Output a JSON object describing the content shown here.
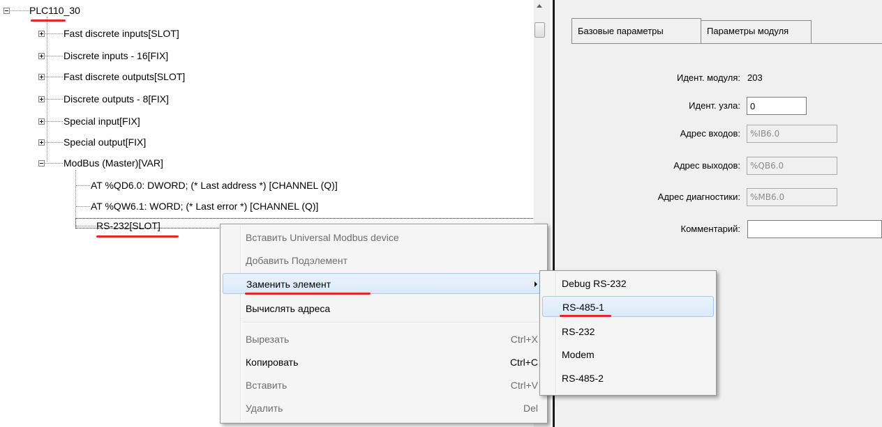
{
  "tree": {
    "root": "PLC110_30",
    "items": [
      "Fast discrete inputs[SLOT]",
      "Discrete inputs - 16[FIX]",
      "Fast discrete outputs[SLOT]",
      "Discrete outputs - 8[FIX]",
      "Special input[FIX]",
      "Special output[FIX]",
      "ModBus (Master)[VAR]"
    ],
    "modbus_children": [
      "AT %QD6.0: DWORD; (* Last address *) [CHANNEL (Q)]",
      "AT %QW6.1: WORD; (* Last error *) [CHANNEL (Q)]",
      "RS-232[SLOT]"
    ]
  },
  "tabs": [
    "Базовые параметры",
    "Параметры модуля"
  ],
  "form": {
    "module_id_label": "Идент. модуля:",
    "module_id_value": "203",
    "node_id_label": "Идент. узла:",
    "node_id_value": "0",
    "input_addr_label": "Адрес входов:",
    "input_addr_value": "%IB6.0",
    "output_addr_label": "Адрес выходов:",
    "output_addr_value": "%QB6.0",
    "diag_addr_label": "Адрес диагностики:",
    "diag_addr_value": "%MB6.0",
    "comment_label": "Комментарий:",
    "comment_value": ""
  },
  "context_menu": {
    "items": [
      {
        "label": "Вставить Universal Modbus device",
        "shortcut": "",
        "enabled": false
      },
      {
        "label": "Добавить Подэлемент",
        "shortcut": "",
        "enabled": false
      },
      {
        "label": "Заменить элемент",
        "shortcut": "",
        "enabled": true
      },
      {
        "label": "Вычислять адреса",
        "shortcut": "",
        "enabled": true
      },
      {
        "label": "Вырезать",
        "shortcut": "Ctrl+X",
        "enabled": false
      },
      {
        "label": "Копировать",
        "shortcut": "Ctrl+C",
        "enabled": true
      },
      {
        "label": "Вставить",
        "shortcut": "Ctrl+V",
        "enabled": false
      },
      {
        "label": "Удалить",
        "shortcut": "Del",
        "enabled": false
      }
    ]
  },
  "submenu": {
    "items": [
      "Debug RS-232",
      "RS-485-1",
      "RS-232",
      "Modem",
      "RS-485-2"
    ]
  },
  "colors": {
    "annotation_underline": "#e4262d",
    "menu_hover_border": "#a8c8ec",
    "split_line": "#1a1a1a"
  }
}
